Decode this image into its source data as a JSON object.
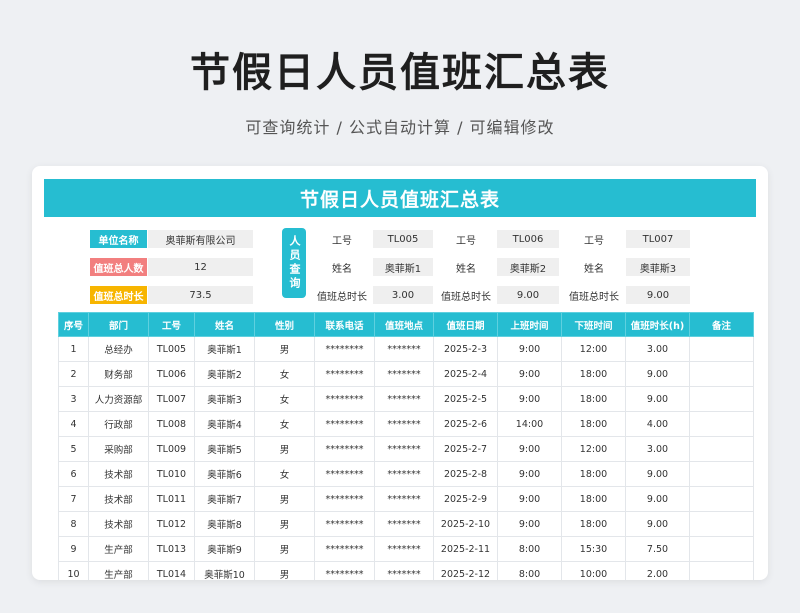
{
  "hero": {
    "title": "节假日人员值班汇总表",
    "subtitle": "可查询统计 /  公式自动计算  /  可编辑修改"
  },
  "sheet": {
    "title": "节假日人员值班汇总表",
    "summary": [
      {
        "label": "单位名称",
        "value": "奥菲斯有限公司",
        "color": "#26bdd1"
      },
      {
        "label": "值班总人数",
        "value": "12",
        "color": "#f27f7f"
      },
      {
        "label": "值班总时长",
        "value": "73.5",
        "color": "#f7b500"
      }
    ],
    "query_label": "人员查询",
    "lookups": [
      {
        "id_label": "工号",
        "id": "TL005",
        "name_label": "姓名",
        "name": "奥菲斯1",
        "hours_label": "值班总时长",
        "hours": "3.00"
      },
      {
        "id_label": "工号",
        "id": "TL006",
        "name_label": "姓名",
        "name": "奥菲斯2",
        "hours_label": "值班总时长",
        "hours": "9.00"
      },
      {
        "id_label": "工号",
        "id": "TL007",
        "name_label": "姓名",
        "name": "奥菲斯3",
        "hours_label": "值班总时长",
        "hours": "9.00"
      }
    ],
    "columns": [
      "序号",
      "部门",
      "工号",
      "姓名",
      "性别",
      "联系电话",
      "值班地点",
      "值班日期",
      "上班时间",
      "下班时间",
      "值班时长(h)",
      "备注"
    ],
    "rows": [
      [
        "1",
        "总经办",
        "TL005",
        "奥菲斯1",
        "男",
        "********",
        "*******",
        "2025-2-3",
        "9:00",
        "12:00",
        "3.00",
        ""
      ],
      [
        "2",
        "财务部",
        "TL006",
        "奥菲斯2",
        "女",
        "********",
        "*******",
        "2025-2-4",
        "9:00",
        "18:00",
        "9.00",
        ""
      ],
      [
        "3",
        "人力资源部",
        "TL007",
        "奥菲斯3",
        "女",
        "********",
        "*******",
        "2025-2-5",
        "9:00",
        "18:00",
        "9.00",
        ""
      ],
      [
        "4",
        "行政部",
        "TL008",
        "奥菲斯4",
        "女",
        "********",
        "*******",
        "2025-2-6",
        "14:00",
        "18:00",
        "4.00",
        ""
      ],
      [
        "5",
        "采购部",
        "TL009",
        "奥菲斯5",
        "男",
        "********",
        "*******",
        "2025-2-7",
        "9:00",
        "12:00",
        "3.00",
        ""
      ],
      [
        "6",
        "技术部",
        "TL010",
        "奥菲斯6",
        "女",
        "********",
        "*******",
        "2025-2-8",
        "9:00",
        "18:00",
        "9.00",
        ""
      ],
      [
        "7",
        "技术部",
        "TL011",
        "奥菲斯7",
        "男",
        "********",
        "*******",
        "2025-2-9",
        "9:00",
        "18:00",
        "9.00",
        ""
      ],
      [
        "8",
        "技术部",
        "TL012",
        "奥菲斯8",
        "男",
        "********",
        "*******",
        "2025-2-10",
        "9:00",
        "18:00",
        "9.00",
        ""
      ],
      [
        "9",
        "生产部",
        "TL013",
        "奥菲斯9",
        "男",
        "********",
        "*******",
        "2025-2-11",
        "8:00",
        "15:30",
        "7.50",
        ""
      ],
      [
        "10",
        "生产部",
        "TL014",
        "奥菲斯10",
        "男",
        "********",
        "*******",
        "2025-2-12",
        "8:00",
        "10:00",
        "2.00",
        ""
      ]
    ]
  }
}
